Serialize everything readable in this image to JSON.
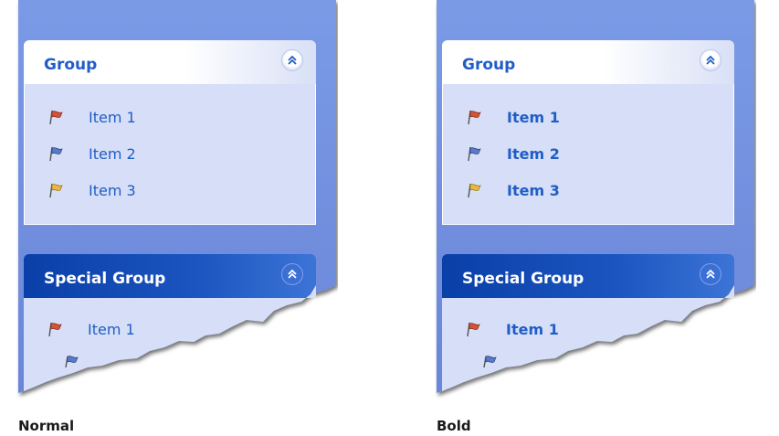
{
  "panels": [
    {
      "caption": "Normal",
      "group": {
        "title": "Group",
        "items": [
          {
            "label": "Item 1",
            "icon": "red-flag-icon",
            "color": "#d0533a"
          },
          {
            "label": "Item 2",
            "icon": "blue-flag-icon",
            "color": "#5a79c8"
          },
          {
            "label": "Item 3",
            "icon": "yellow-flag-icon",
            "color": "#e8b940"
          }
        ]
      },
      "special_group": {
        "title": "Special Group",
        "items": [
          {
            "label": "Item 1",
            "icon": "red-flag-icon",
            "color": "#d0533a"
          },
          {
            "label": "",
            "icon": "blue-flag-icon",
            "color": "#5a79c8"
          }
        ]
      }
    },
    {
      "caption": "Bold",
      "group": {
        "title": "Group",
        "items": [
          {
            "label": "Item 1",
            "icon": "red-flag-icon",
            "color": "#d0533a"
          },
          {
            "label": "Item 2",
            "icon": "blue-flag-icon",
            "color": "#5a79c8"
          },
          {
            "label": "Item 3",
            "icon": "yellow-flag-icon",
            "color": "#e8b940"
          }
        ]
      },
      "special_group": {
        "title": "Special Group",
        "items": [
          {
            "label": "Item 1",
            "icon": "red-flag-icon",
            "color": "#d0533a"
          },
          {
            "label": "",
            "icon": "blue-flag-icon",
            "color": "#5a79c8"
          }
        ]
      }
    }
  ],
  "colors": {
    "panel_background": "#7b97e6",
    "accent": "#215dc6",
    "special_header": "#0a3fa8",
    "body_background": "#d6dff7"
  }
}
